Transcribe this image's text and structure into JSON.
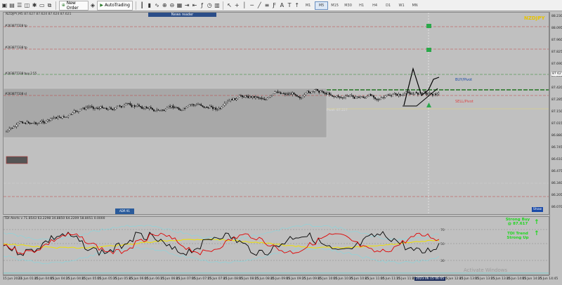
{
  "toolbar": {
    "new_order_label": "New Order",
    "auto_trading_label": "AutoTrading",
    "timeframes": [
      "M1",
      "M5",
      "M15",
      "M30",
      "H1",
      "H4",
      "D1",
      "W1",
      "MN"
    ],
    "active_timeframe": "M5"
  },
  "chart": {
    "symbol_info": "NZDJPY,M5 87.627 87.624 87.624 87.621",
    "pair_name": "NZDJPY",
    "news_reader_label": "News reader",
    "order_lines": [
      {
        "label": "#263877328 tp"
      },
      {
        "label": "#263877338 tp"
      },
      {
        "label": "#263877338 buy 2.55"
      },
      {
        "label": "#263877338 sl"
      }
    ],
    "pivot_buy_label": "BUY/Pivot",
    "pivot_sell_label": "SELL/Pivot",
    "pivot_marker_label": "Pivot: 87.227",
    "badge_label": "ADR 91",
    "show_button_label": "Show",
    "price_axis": [
      "88.230",
      "88.095",
      "87.960",
      "87.825",
      "87.690",
      "87.555",
      "87.420",
      "87.285",
      "87.150",
      "87.015",
      "86.880",
      "86.745",
      "86.610",
      "86.475",
      "86.340",
      "86.205",
      "86.070"
    ],
    "current_price": "87.621",
    "time_axis": [
      "15 Jun 2023",
      "15 Jun 01:45",
      "15 Jun 04:05",
      "15 Jun 04:25",
      "15 Jun 04:45",
      "15 Jun 05:05",
      "15 Jun 05:25",
      "15 Jun 05:45",
      "15 Jun 06:05",
      "15 Jun 06:25",
      "15 Jun 06:45",
      "15 Jun 07:05",
      "15 Jun 07:25",
      "15 Jun 07:45",
      "15 Jun 08:05",
      "15 Jun 08:25",
      "15 Jun 08:45",
      "15 Jun 09:05",
      "15 Jun 09:25",
      "15 Jun 09:45",
      "15 Jun 10:05",
      "15 Jun 10:25",
      "15 Jun 10:45",
      "15 Jun 11:05",
      "15 Jun 11:25",
      "15 Jun 11:45",
      "15 Jun 12:05",
      "15 Jun 12:25",
      "15 Jun 12:45",
      "15 Jun 13:05",
      "15 Jun 13:25",
      "15 Jun 13:45",
      "15 Jun 14:05",
      "15 Jun 14:25",
      "15 Jun 14:45"
    ],
    "cursor_time": "2023.06.15 06:05"
  },
  "indicator": {
    "title": "TDI Alerts v 71.8543 63.2298 34.8850 64.2209 58.8051 0.0000",
    "levels": [
      "70",
      "50",
      "30"
    ],
    "signal_line1": "Strong Buy",
    "signal_line2": "@ 87.617",
    "trend_line1": "TDI Trend",
    "trend_line2": "Strong Up",
    "up_arrow": "↑"
  },
  "watermark": "Activate Windows",
  "colors": {
    "accent_gold": "#e6c200",
    "signal_green": "#1dd71d",
    "tdi_red": "#e00000",
    "tdi_yellow": "#f0e000",
    "band_cyan": "#80d8e0"
  }
}
